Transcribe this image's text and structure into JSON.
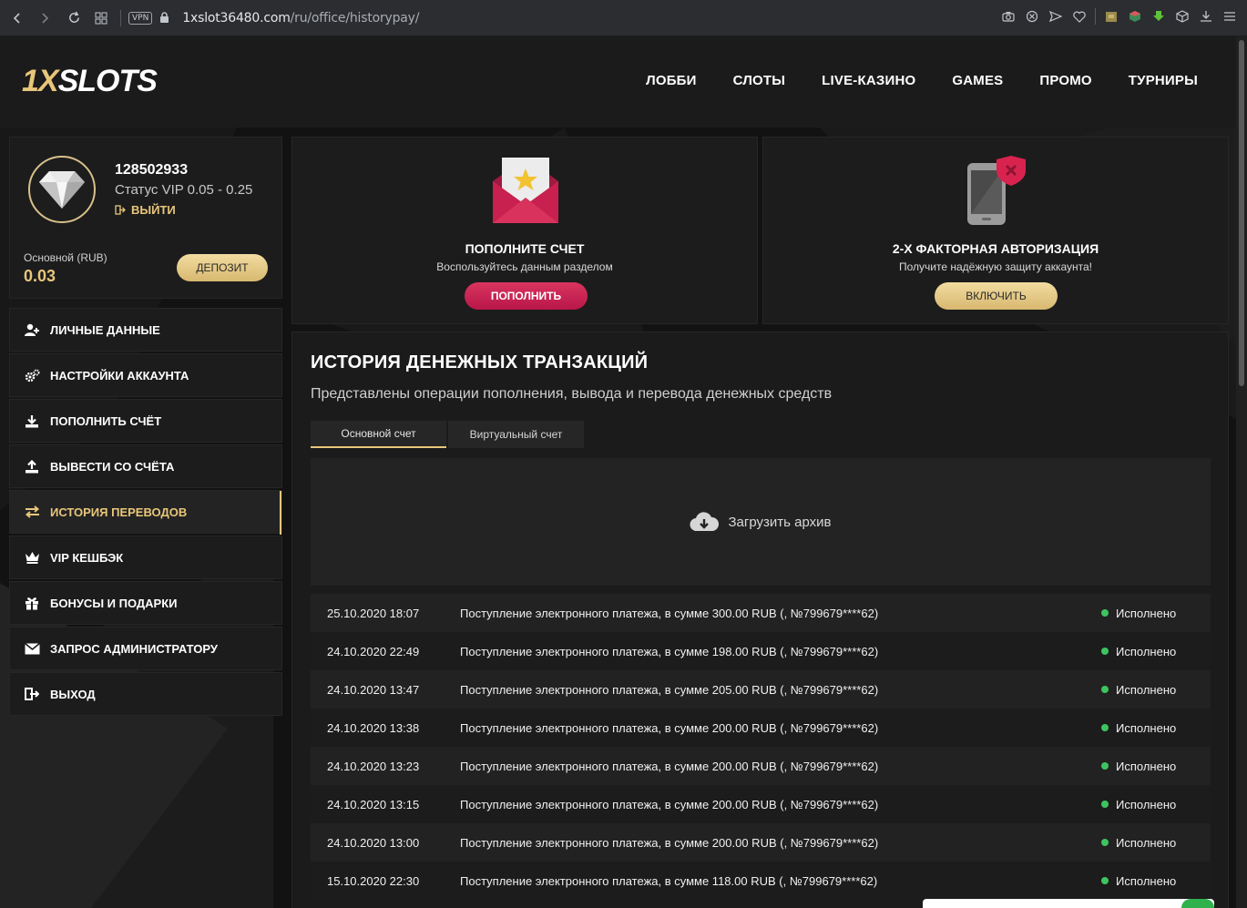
{
  "browser": {
    "url_host": "1xslot36480.com",
    "url_path": "/ru/office/historypay/",
    "vpn_label": "VPN"
  },
  "header": {
    "logo_one": "1X",
    "logo_rest": "SLOTS",
    "nav": [
      "ЛОББИ",
      "СЛОТЫ",
      "LIVE-КАЗИНО",
      "GAMES",
      "ПРОМО",
      "ТУРНИРЫ"
    ]
  },
  "profile": {
    "user_id": "128502933",
    "vip_status": "Статус VIP 0.05 - 0.25",
    "logout_label": "ВЫЙТИ",
    "balance_label": "Основной (RUB)",
    "balance_value": "0.03",
    "deposit_label": "ДЕПОЗИТ"
  },
  "menu": [
    {
      "label": "ЛИЧНЫЕ ДАННЫЕ",
      "icon": "user-add-icon"
    },
    {
      "label": "НАСТРОЙКИ АККАУНТА",
      "icon": "gears-icon"
    },
    {
      "label": "ПОПОЛНИТЬ СЧЁТ",
      "icon": "download-icon"
    },
    {
      "label": "ВЫВЕСТИ СО СЧЁТА",
      "icon": "upload-icon"
    },
    {
      "label": "ИСТОРИЯ ПЕРЕВОДОВ",
      "icon": "transfer-arrows-icon",
      "active": true
    },
    {
      "label": "VIP КЕШБЭК",
      "icon": "crown-icon"
    },
    {
      "label": "БОНУСЫ И ПОДАРКИ",
      "icon": "gift-icon"
    },
    {
      "label": "ЗАПРОС АДМИНИСТРАТОРУ",
      "icon": "envelope-icon"
    },
    {
      "label": "ВЫХОД",
      "icon": "exit-icon"
    }
  ],
  "cards": {
    "deposit": {
      "title": "ПОПОЛНИТЕ СЧЕТ",
      "subtitle": "Воспользуйтесь данным разделом",
      "button": "ПОПОЛНИТЬ"
    },
    "twofa": {
      "title": "2-Х ФАКТОРНАЯ АВТОРИЗАЦИЯ",
      "subtitle": "Получите надёжную защиту аккаунта!",
      "button": "ВКЛЮЧИТЬ"
    }
  },
  "history": {
    "title": "ИСТОРИЯ ДЕНЕЖНЫХ ТРАНЗАКЦИЙ",
    "subtitle": "Представлены операции пополнения, вывода и перевода денежных средств",
    "tabs": [
      "Основной счет",
      "Виртуальный счет"
    ],
    "archive_label": "Загрузить архив",
    "rows": [
      {
        "date": "25.10.2020 18:07",
        "desc": "Поступление электронного платежа, в сумме 300.00 RUB (, №799679****62)",
        "status": "Исполнено"
      },
      {
        "date": "24.10.2020 22:49",
        "desc": "Поступление электронного платежа, в сумме 198.00 RUB (, №799679****62)",
        "status": "Исполнено"
      },
      {
        "date": "24.10.2020 13:47",
        "desc": "Поступление электронного платежа, в сумме 205.00 RUB (, №799679****62)",
        "status": "Исполнено"
      },
      {
        "date": "24.10.2020 13:38",
        "desc": "Поступление электронного платежа, в сумме 200.00 RUB (, №799679****62)",
        "status": "Исполнено"
      },
      {
        "date": "24.10.2020 13:23",
        "desc": "Поступление электронного платежа, в сумме 200.00 RUB (, №799679****62)",
        "status": "Исполнено"
      },
      {
        "date": "24.10.2020 13:15",
        "desc": "Поступление электронного платежа, в сумме 200.00 RUB (, №799679****62)",
        "status": "Исполнено"
      },
      {
        "date": "24.10.2020 13:00",
        "desc": "Поступление электронного платежа, в сумме 200.00 RUB (, №799679****62)",
        "status": "Исполнено"
      },
      {
        "date": "15.10.2020 22:30",
        "desc": "Поступление электронного платежа, в сумме 118.00 RUB (, №799679****62)",
        "status": "Исполнено"
      }
    ]
  },
  "colors": {
    "accent_gold": "#e8c67a",
    "accent_red": "#c8204f",
    "status_green": "#3ec45f"
  }
}
